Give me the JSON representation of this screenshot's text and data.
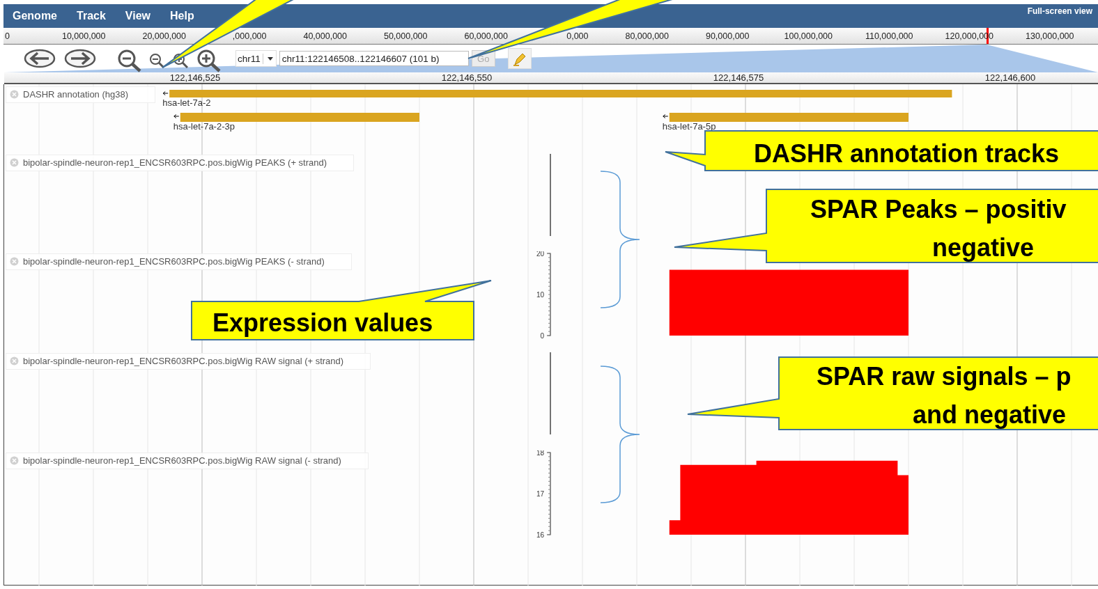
{
  "menu": [
    "Genome",
    "Track",
    "View",
    "Help"
  ],
  "fullscreen_link": "Full-screen view",
  "overview": {
    "labels": [
      "0",
      "10,000,000",
      "20,000,000",
      ",000,000",
      "40,000,000",
      "50,000,000",
      "60,000,000",
      "0,000",
      "80,000,000",
      "90,000,000",
      "100,000,000",
      "110,000,000",
      "120,000,000",
      "130,000,000"
    ],
    "level": 0.898
  },
  "toolbar": {
    "chromosome": "chr11",
    "location": "chr11:122146508..122146607 (101 b)",
    "go_button": {
      "label": "Go",
      "disabled": true
    }
  },
  "ruler_labels": [
    "122,146,525",
    "122,146,550",
    "122,146,575",
    "122,146,600"
  ],
  "tracks": [
    {
      "kind": "features",
      "label": "DASHR annotation (hg38)",
      "features": [
        {
          "name": "hsa-let-7a-2",
          "reverse": true
        },
        {
          "name": "hsa-let-7a-2-3p",
          "reverse": true
        },
        {
          "name": "hsa-let-7a-5p",
          "reverse": true
        }
      ]
    },
    {
      "kind": "wiggle",
      "label": "bipolar-spindle-neuron-rep1_ENCSR603RPC.pos.bigWig PEAKS (+ strand)"
    },
    {
      "kind": "wiggle",
      "label": "bipolar-spindle-neuron-rep1_ENCSR603RPC.pos.bigWig PEAKS (- strand)",
      "axis_labels": [
        "20",
        "10",
        "0"
      ]
    },
    {
      "kind": "wiggle",
      "label": "bipolar-spindle-neuron-rep1_ENCSR603RPC.pos.bigWig RAW signal (+ strand)"
    },
    {
      "kind": "wiggle",
      "label": "bipolar-spindle-neuron-rep1_ENCSR603RPC.pos.bigWig RAW signal (- strand)",
      "axis_labels": [
        "18",
        "17",
        "16"
      ]
    }
  ],
  "callouts": [
    {
      "lines": [
        "DASHR annotation tracks"
      ]
    },
    {
      "lines": [
        "SPAR Peaks – positiv",
        "negative"
      ]
    },
    {
      "lines": [
        "Expression values"
      ]
    },
    {
      "lines": [
        "SPAR raw signals – p",
        "and negative"
      ]
    }
  ]
}
